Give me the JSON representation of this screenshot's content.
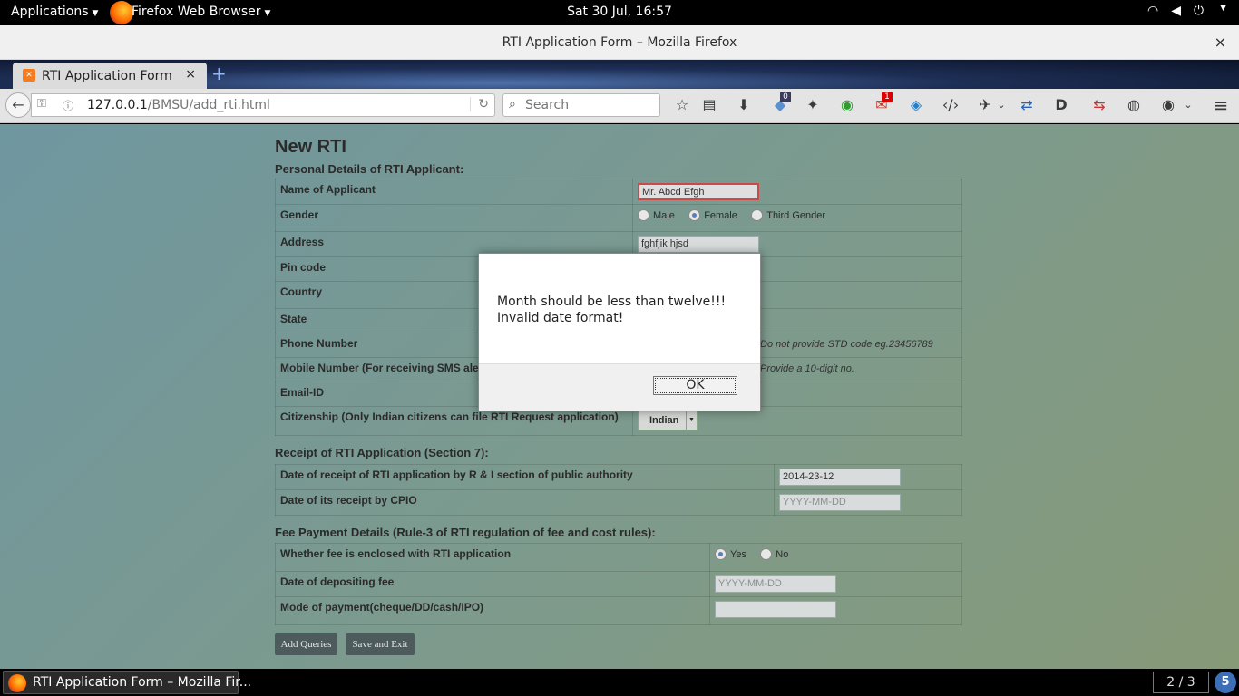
{
  "topbar": {
    "applications": "Applications",
    "app_name": "Firefox Web Browser",
    "clock": "Sat 30 Jul, 16:57"
  },
  "window": {
    "title": "RTI Application Form – Mozilla Firefox",
    "close": "×"
  },
  "tab": {
    "title": "RTI Application Form",
    "close": "×",
    "new_tab": "+"
  },
  "navbar": {
    "url_host": "127.0.0.1",
    "url_path": "/BMSU/add_rti.html",
    "search_placeholder": "Search",
    "badge_count_1": "0",
    "badge_count_2": "1"
  },
  "form": {
    "title": "New RTI",
    "personal_section": "Personal Details of RTI Applicant:",
    "labels": {
      "name": "Name of Applicant",
      "gender": "Gender",
      "address": "Address",
      "pincode": "Pin code",
      "country": "Country",
      "state": "State",
      "phone": "Phone Number",
      "mobile": "Mobile Number (For receiving SMS alerts)",
      "email": "Email-ID",
      "citizenship": "Citizenship (Only Indian citizens can file RTI Request application)"
    },
    "values": {
      "name": "Mr. Abcd Efgh",
      "address": "fghfjik hjsd",
      "citizenship": "Indian"
    },
    "gender_options": [
      "Male",
      "Female",
      "Third Gender"
    ],
    "phone_note": "Do not provide STD code eg.23456789",
    "mobile_note": "Provide a 10-digit no.",
    "receipt_section": "Receipt of RTI Application (Section 7):",
    "receipt_labels": {
      "date_receipt": "Date of receipt of RTI application by R & I section of public authority",
      "date_cpio": "Date of its receipt by CPIO"
    },
    "receipt_values": {
      "date_receipt": "2014-23-12",
      "date_cpio_placeholder": "YYYY-MM-DD"
    },
    "fee_section": "Fee Payment Details (Rule-3 of RTI regulation of fee and cost rules):",
    "fee_labels": {
      "enclosed": "Whether fee is enclosed with RTI application",
      "deposit_date": "Date of depositing fee",
      "mode": "Mode of payment(cheque/DD/cash/IPO)"
    },
    "fee_options": [
      "Yes",
      "No"
    ],
    "fee_deposit_placeholder": "YYYY-MM-DD",
    "add_queries": "Add Queries",
    "save_exit": "Save and Exit"
  },
  "dialog": {
    "line1": "Month should be less than twelve!!!",
    "line2": "Invalid date format!",
    "ok": "OK"
  },
  "taskbar": {
    "task_title": "RTI Application Form – Mozilla Fir...",
    "workspace": "2 / 3",
    "notifications": "5"
  }
}
